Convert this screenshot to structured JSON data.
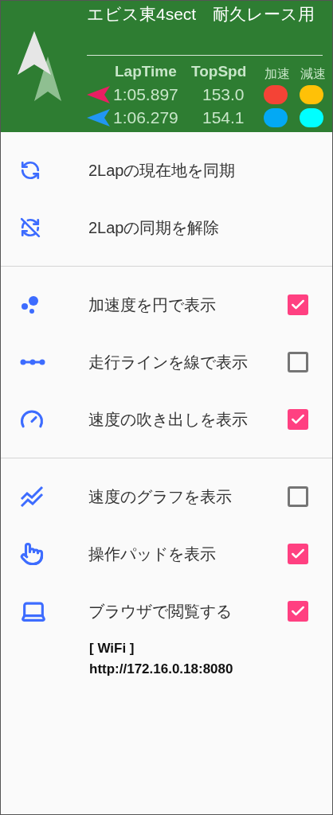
{
  "header": {
    "title": "エビス東4sect　耐久レース用",
    "columns": [
      "LapTime",
      "TopSpd",
      "加速",
      "減速"
    ],
    "laps": [
      {
        "time": "1:05.897",
        "speed": "153.0",
        "color": "#e91e63",
        "accel": {
          "color": "#f44336"
        },
        "decel": {
          "color": "#ffc107"
        }
      },
      {
        "time": "1:06.279",
        "speed": "154.1",
        "color": "#2196f3",
        "accel": {
          "color": "#03a9f4"
        },
        "decel": {
          "color": "#00ffff"
        }
      }
    ]
  },
  "sections": [
    {
      "items": [
        {
          "kind": "action",
          "label": "2Lapの現在地を同期"
        },
        {
          "kind": "action",
          "label": "2Lapの同期を解除"
        }
      ]
    },
    {
      "items": [
        {
          "kind": "toggle",
          "label": "加速度を円で表示",
          "checked": true
        },
        {
          "kind": "toggle",
          "label": "走行ラインを線で表示",
          "checked": false
        },
        {
          "kind": "toggle",
          "label": "速度の吹き出しを表示",
          "checked": true
        }
      ]
    },
    {
      "items": [
        {
          "kind": "toggle",
          "label": "速度のグラフを表示",
          "checked": false
        },
        {
          "kind": "toggle",
          "label": "操作パッドを表示",
          "checked": true
        },
        {
          "kind": "toggle",
          "label": "ブラウザで閲覧する",
          "checked": true
        }
      ]
    }
  ],
  "wifi": {
    "label": "[ WiFi ]",
    "url": "http://172.16.0.18:8080"
  }
}
